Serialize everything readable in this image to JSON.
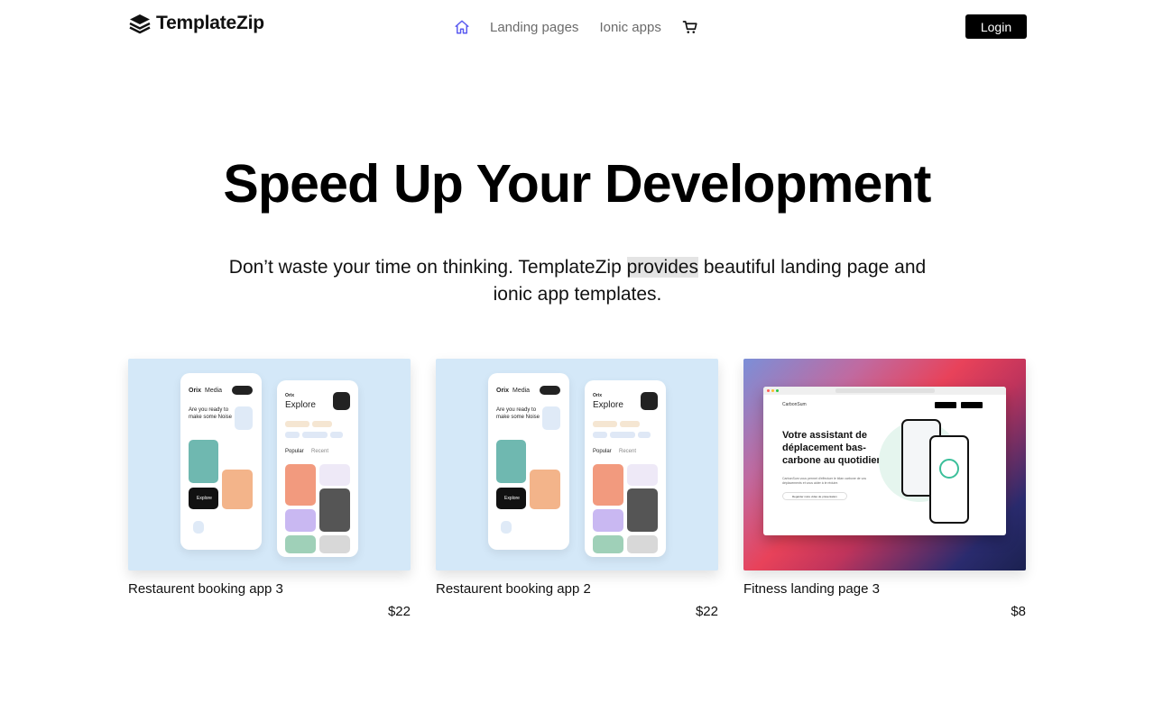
{
  "nav": {
    "brand": "TemplateZip",
    "links": [
      "Landing pages",
      "Ionic apps"
    ],
    "login_label": "Login",
    "home_icon": "home-icon",
    "cart_icon": "cart-icon",
    "accent_color": "#5b5bf0"
  },
  "hero": {
    "title": "Speed Up Your Development",
    "subtitle_before": "Don’t waste your time on thinking. TemplateZip ",
    "subtitle_highlight": "provides",
    "subtitle_after": " beautiful landing page and ionic app templates."
  },
  "cards": [
    {
      "title": "Restaurent booking app 3",
      "price": "$22",
      "mock": {
        "app_name": "Orix",
        "app_name_suffix": "Media",
        "headline": "Are you ready to make some Noise",
        "explore": "Explore",
        "tabs": [
          "Popular",
          "Recent"
        ],
        "button": "Explore"
      }
    },
    {
      "title": "Restaurent booking app 2",
      "price": "$22",
      "mock": {
        "app_name": "Orix",
        "app_name_suffix": "Media",
        "headline": "Are you ready to make some Noise",
        "explore": "Explore",
        "tabs": [
          "Popular",
          "Recent"
        ],
        "button": "Explore"
      }
    },
    {
      "title": "Fitness landing page 3",
      "price": "$8",
      "mock": {
        "logo": "CarbonSum",
        "headline": "Votre assistant de déplacement bas-carbone au quotidien",
        "body": "CarbonSum vous permet d'effectuer le bilan carbone de vos déplacements et vous aider à le réduire.",
        "cta": "Regarder notre vidéo de présentation"
      }
    }
  ]
}
